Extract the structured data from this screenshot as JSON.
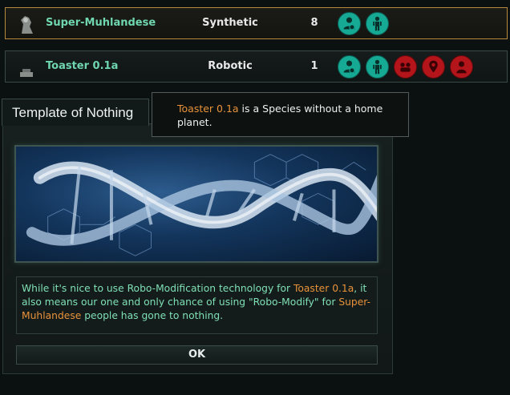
{
  "species_rows": [
    {
      "name": "Super-Muhlandese",
      "type": "Synthetic",
      "count": "8",
      "selected": true,
      "icons": [
        "gear-person-icon",
        "humanoid-figure-icon"
      ]
    },
    {
      "name": "Toaster 0.1a",
      "type": "Robotic",
      "count": "1",
      "selected": false,
      "icons": [
        "gear-person-icon",
        "humanoid-figure-icon",
        "purge-icon",
        "pin-person-icon",
        "person-icon"
      ]
    }
  ],
  "dialog": {
    "title": "Template of Nothing",
    "image": "dna-double-helix-illustration",
    "message_part1": "While it's nice to use Robo-Modification technology for ",
    "message_species1": "Toaster 0.1a",
    "message_part2": ", it also means our one and only chance of using \"Robo-Modify\" for ",
    "message_species2": "Super-Muhlandese",
    "message_part3": " people has gone to nothing.",
    "ok_label": "OK"
  },
  "tooltip": {
    "species": "Toaster 0.1a",
    "text": " is a Species without a home planet."
  },
  "colors": {
    "species_name": "#6fd6b0",
    "highlight": "#e8923a",
    "message_text": "#7fe0b6",
    "teal_icon": "#16a994",
    "red_icon": "#b3151b",
    "selected_border": "#b8893a"
  }
}
